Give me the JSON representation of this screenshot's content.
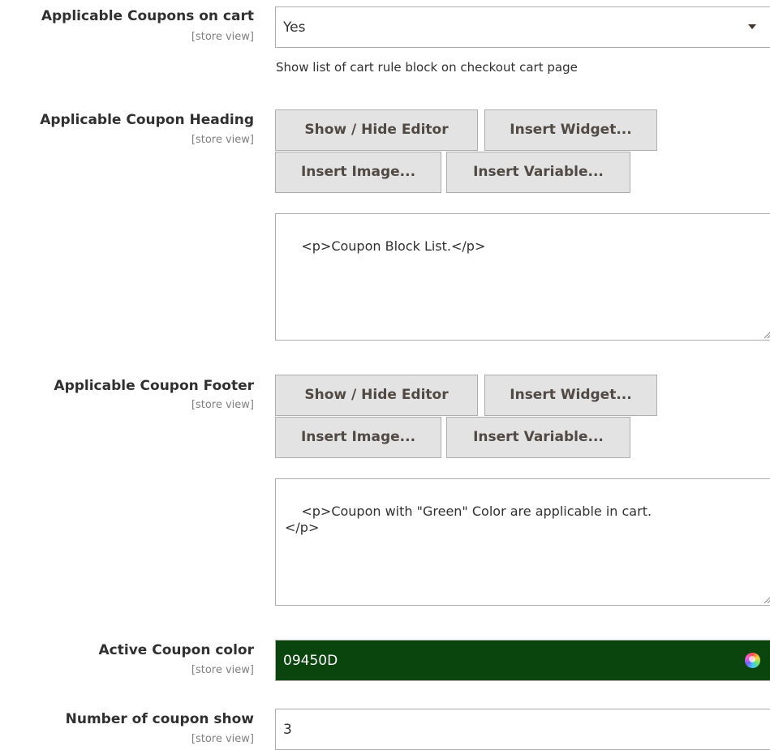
{
  "coupons_on_cart": {
    "label": "Applicable Coupons on cart",
    "scope": "[store view]",
    "selected": "Yes",
    "note": "Show list of cart rule block on checkout cart page"
  },
  "coupon_heading": {
    "label": "Applicable Coupon Heading",
    "scope": "[store view]",
    "buttons": {
      "show_hide": "Show / Hide Editor",
      "insert_widget": "Insert Widget...",
      "insert_image": "Insert Image...",
      "insert_variable": "Insert Variable..."
    },
    "value": "<p>Coupon Block List.</p>"
  },
  "coupon_footer": {
    "label": "Applicable Coupon Footer",
    "scope": "[store view]",
    "buttons": {
      "show_hide": "Show / Hide Editor",
      "insert_widget": "Insert Widget...",
      "insert_image": "Insert Image...",
      "insert_variable": "Insert Variable..."
    },
    "value": "<p>Coupon with \"Green\" Color are applicable in cart.\n</p>"
  },
  "active_color": {
    "label": "Active Coupon color",
    "scope": "[store view]",
    "value": "09450D",
    "hex": "#09450D"
  },
  "coupon_count": {
    "label": "Number of coupon show",
    "scope": "[store view]",
    "value": "3"
  }
}
